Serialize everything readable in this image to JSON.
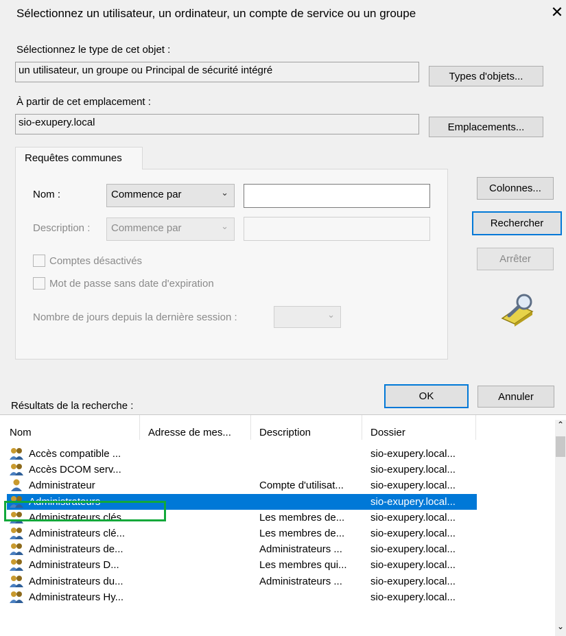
{
  "dialog": {
    "title": "Sélectionnez un utilisateur, un ordinateur, un compte de service ou un groupe",
    "close_glyph": "✕"
  },
  "object_type": {
    "label": "Sélectionnez le type de cet objet :",
    "value": "un utilisateur, un groupe ou Principal de sécurité intégré",
    "button": "Types d'objets..."
  },
  "location": {
    "label": "À partir de cet emplacement :",
    "value": "sio-exupery.local",
    "button": "Emplacements..."
  },
  "tab": {
    "label": "Requêtes communes",
    "name_label": "Nom :",
    "name_mode": "Commence par",
    "description_label": "Description :",
    "description_mode": "Commence par",
    "disabled_accounts": "Comptes désactivés",
    "no_expiry_password": "Mot de passe sans date d'expiration",
    "days_since_logon": "Nombre de jours depuis la dernière session :"
  },
  "side_buttons": {
    "columns": "Colonnes...",
    "search": "Rechercher",
    "stop": "Arrêter"
  },
  "footer": {
    "results_label": "Résultats de la recherche :",
    "ok": "OK",
    "cancel": "Annuler"
  },
  "results": {
    "columns": [
      "Nom",
      "Adresse de mes...",
      "Description",
      "Dossier"
    ],
    "rows": [
      {
        "icon": "group-icon",
        "name": "Accès compatible ...",
        "email": "",
        "description": "",
        "folder": "sio-exupery.local..."
      },
      {
        "icon": "group-icon",
        "name": "Accès DCOM serv...",
        "email": "",
        "description": "",
        "folder": "sio-exupery.local..."
      },
      {
        "icon": "user-icon",
        "name": "Administrateur",
        "email": "",
        "description": "Compte d'utilisat...",
        "folder": "sio-exupery.local..."
      },
      {
        "icon": "group-icon",
        "name": "Administrateurs",
        "email": "",
        "description": "",
        "folder": "sio-exupery.local..."
      },
      {
        "icon": "group-icon",
        "name": "Administrateurs clés",
        "email": "",
        "description": "Les membres de...",
        "folder": "sio-exupery.local..."
      },
      {
        "icon": "group-icon",
        "name": "Administrateurs clé...",
        "email": "",
        "description": "Les membres de...",
        "folder": "sio-exupery.local..."
      },
      {
        "icon": "group-icon",
        "name": "Administrateurs de...",
        "email": "",
        "description": "Administrateurs ...",
        "folder": "sio-exupery.local..."
      },
      {
        "icon": "group-icon",
        "name": "Administrateurs D...",
        "email": "",
        "description": "Les membres qui...",
        "folder": "sio-exupery.local..."
      },
      {
        "icon": "group-icon",
        "name": "Administrateurs du...",
        "email": "",
        "description": "Administrateurs ...",
        "folder": "sio-exupery.local..."
      },
      {
        "icon": "group-icon",
        "name": "Administrateurs Hy...",
        "email": "",
        "description": "",
        "folder": "sio-exupery.local..."
      }
    ],
    "selected_row": "Administrateurs"
  },
  "colors": {
    "selection": "#0078d7",
    "highlight_box": "#11a83a"
  }
}
